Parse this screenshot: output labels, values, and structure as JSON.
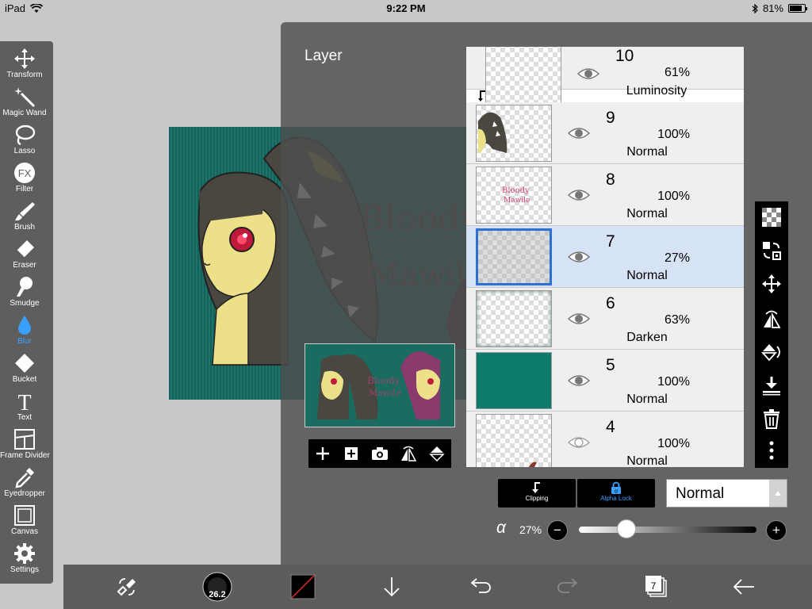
{
  "status_bar": {
    "device": "iPad",
    "time": "9:22 PM",
    "battery_text": "81%",
    "battery_level": 0.81
  },
  "toolbar": {
    "items": [
      {
        "label": "Transform",
        "icon": "transform-icon"
      },
      {
        "label": "Magic Wand",
        "icon": "magic-wand-icon"
      },
      {
        "label": "Lasso",
        "icon": "lasso-icon"
      },
      {
        "label": "Filter",
        "icon": "fx-icon"
      },
      {
        "label": "Brush",
        "icon": "brush-icon"
      },
      {
        "label": "Eraser",
        "icon": "eraser-icon"
      },
      {
        "label": "Smudge",
        "icon": "smudge-icon"
      },
      {
        "label": "Blur",
        "icon": "blur-drop-icon",
        "active": true
      },
      {
        "label": "Bucket",
        "icon": "bucket-icon"
      },
      {
        "label": "Text",
        "icon": "text-icon"
      },
      {
        "label": "Frame Divider",
        "icon": "frame-divider-icon"
      },
      {
        "label": "Eyedropper",
        "icon": "eyedropper-icon"
      },
      {
        "label": "Canvas",
        "icon": "canvas-icon"
      },
      {
        "label": "Settings",
        "icon": "gear-icon"
      }
    ]
  },
  "canvas": {
    "background_color": "#1a6b60",
    "artwork_text_line1": "Bloody",
    "artwork_text_line2": "Mawile"
  },
  "layer_panel": {
    "title": "Layer",
    "preview_buttons": [
      "add-layer-icon",
      "add-layer-copy-icon",
      "camera-icon",
      "flip-horizontal-icon",
      "flip-vertical-icon"
    ],
    "layers": [
      {
        "number": "10",
        "opacity": "61%",
        "blend": "Luminosity",
        "visible": true,
        "clipped": true
      },
      {
        "number": "9",
        "opacity": "100%",
        "blend": "Normal",
        "visible": true
      },
      {
        "number": "8",
        "opacity": "100%",
        "blend": "Normal",
        "visible": true
      },
      {
        "number": "7",
        "opacity": "27%",
        "blend": "Normal",
        "visible": true,
        "selected": true
      },
      {
        "number": "6",
        "opacity": "63%",
        "blend": "Darken",
        "visible": true
      },
      {
        "number": "5",
        "opacity": "100%",
        "blend": "Normal",
        "visible": true
      },
      {
        "number": "4",
        "opacity": "100%",
        "blend": "Normal",
        "visible": false
      }
    ],
    "right_tools": [
      "checkerboard-icon",
      "swap-layer-icon",
      "move-icon",
      "flip-horizontal-icon",
      "flip-vertical-icon",
      "merge-down-icon",
      "trash-icon",
      "more-icon"
    ],
    "clipping_label": "Clipping",
    "alpha_lock_label": "Alpha Lock",
    "blend_mode": "Normal",
    "alpha_symbol": "α",
    "opacity_text": "27%",
    "opacity_value": 0.27
  },
  "bottom_bar": {
    "brush_size": "26.2",
    "layer_count": "7",
    "buttons": [
      "transform-swap-icon",
      "brush-size-icon",
      "color-swatch-icon",
      "down-arrow-icon",
      "undo-icon",
      "redo-icon",
      "layers-icon",
      "back-arrow-icon"
    ]
  },
  "colors": {
    "accent_blue": "#3aa0ff",
    "selected_layer": "#d6e3f7",
    "toolbar_bg": "#5e5e5e"
  }
}
